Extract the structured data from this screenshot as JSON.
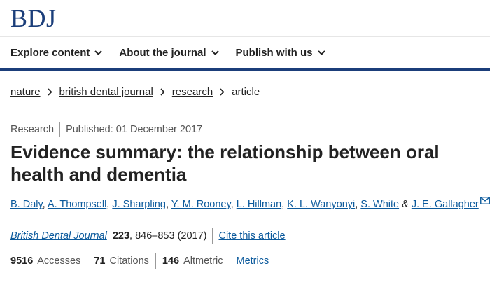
{
  "header": {
    "logo": "BDJ"
  },
  "nav": {
    "items": [
      {
        "label": "Explore content"
      },
      {
        "label": "About the journal"
      },
      {
        "label": "Publish with us"
      }
    ]
  },
  "breadcrumb": {
    "items": [
      "nature",
      "british dental journal",
      "research",
      "article"
    ]
  },
  "meta": {
    "type": "Research",
    "published": "Published: 01 December 2017"
  },
  "article": {
    "title": "Evidence summary: the relationship between oral health and dementia",
    "authors": [
      "B. Daly",
      "A. Thompsell",
      "J. Sharpling",
      "Y. M. Rooney",
      "L. Hillman",
      "K. L. Wanyonyi",
      "S. White",
      "J. E. Gallagher"
    ],
    "author_separator": ",",
    "author_last_separator": "&",
    "journal": "British Dental Journal",
    "volume": "223",
    "citation_rest": ", 846–853 (2017)",
    "cite_link": "Cite this article"
  },
  "metrics": {
    "accesses_value": "9516",
    "accesses_label": "Accesses",
    "citations_value": "71",
    "citations_label": "Citations",
    "altmetric_value": "146",
    "altmetric_label": "Altmetric",
    "metrics_link": "Metrics"
  },
  "colors": {
    "brand": "#1b3e7a",
    "link": "#0c5a9c",
    "text": "#222222",
    "muted": "#555555"
  }
}
